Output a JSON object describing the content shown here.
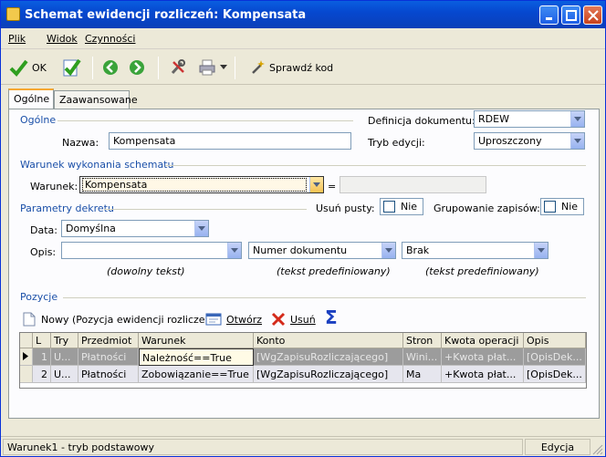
{
  "window": {
    "title": "Schemat ewidencji rozliczeń: Kompensata"
  },
  "menu": [
    "Plik",
    "Widok",
    "Czynności"
  ],
  "toolbar": {
    "ok_label": "OK",
    "verify_label": "Sprawdź kod"
  },
  "tabs": [
    "Ogólne",
    "Zaawansowane"
  ],
  "general": {
    "section": "Ogólne",
    "name_label": "Nazwa:",
    "name_value": "Kompensata",
    "doc_def_label": "Definicja dokumentu:",
    "doc_def_value": "RDEW",
    "edit_mode_label": "Tryb edycji:",
    "edit_mode_value": "Uproszczony"
  },
  "condition": {
    "section": "Warunek wykonania schematu",
    "label": "Warunek:",
    "value": "Kompensata",
    "eq": "="
  },
  "decree": {
    "section": "Parametry dekretu",
    "remove_empty_label": "Usuń pusty:",
    "remove_empty_value": "Nie",
    "grouping_label": "Grupowanie zapisów:",
    "grouping_value": "Nie",
    "date_label": "Data:",
    "date_value": "Domyślna",
    "desc_label": "Opis:",
    "desc_value": "",
    "desc_hint": "(dowolny tekst)",
    "doc_num_value": "Numer dokumentu",
    "doc_num_hint": "(tekst predefiniowany)",
    "brak_value": "Brak",
    "brak_hint": "(tekst predefiniowany)"
  },
  "positions": {
    "section": "Pozycje",
    "new_label": "Nowy (Pozycja ewidencji rozliczeń)",
    "open_label": "Otwórz",
    "delete_label": "Usuń",
    "sigma": "Σ"
  },
  "grid": {
    "columns": [
      "L",
      "Try",
      "Przedmiot",
      "Warunek",
      "Konto",
      "Stron",
      "Kwota operacji",
      "Opis"
    ],
    "rows": [
      [
        "1",
        "U...",
        "Płatności",
        "Należność==True",
        "[WgZapisuRozliczającego]",
        "Wini...",
        "+Kwota płat...",
        "[OpisDek..."
      ],
      [
        "2",
        "U...",
        "Płatności",
        "Zobowiązanie==True",
        "[WgZapisuRozliczającego]",
        "Ma",
        "+Kwota płat...",
        "[OpisDek..."
      ]
    ]
  },
  "status": {
    "left": "Warunek1 - tryb podstawowy",
    "mode": "Edycja"
  }
}
